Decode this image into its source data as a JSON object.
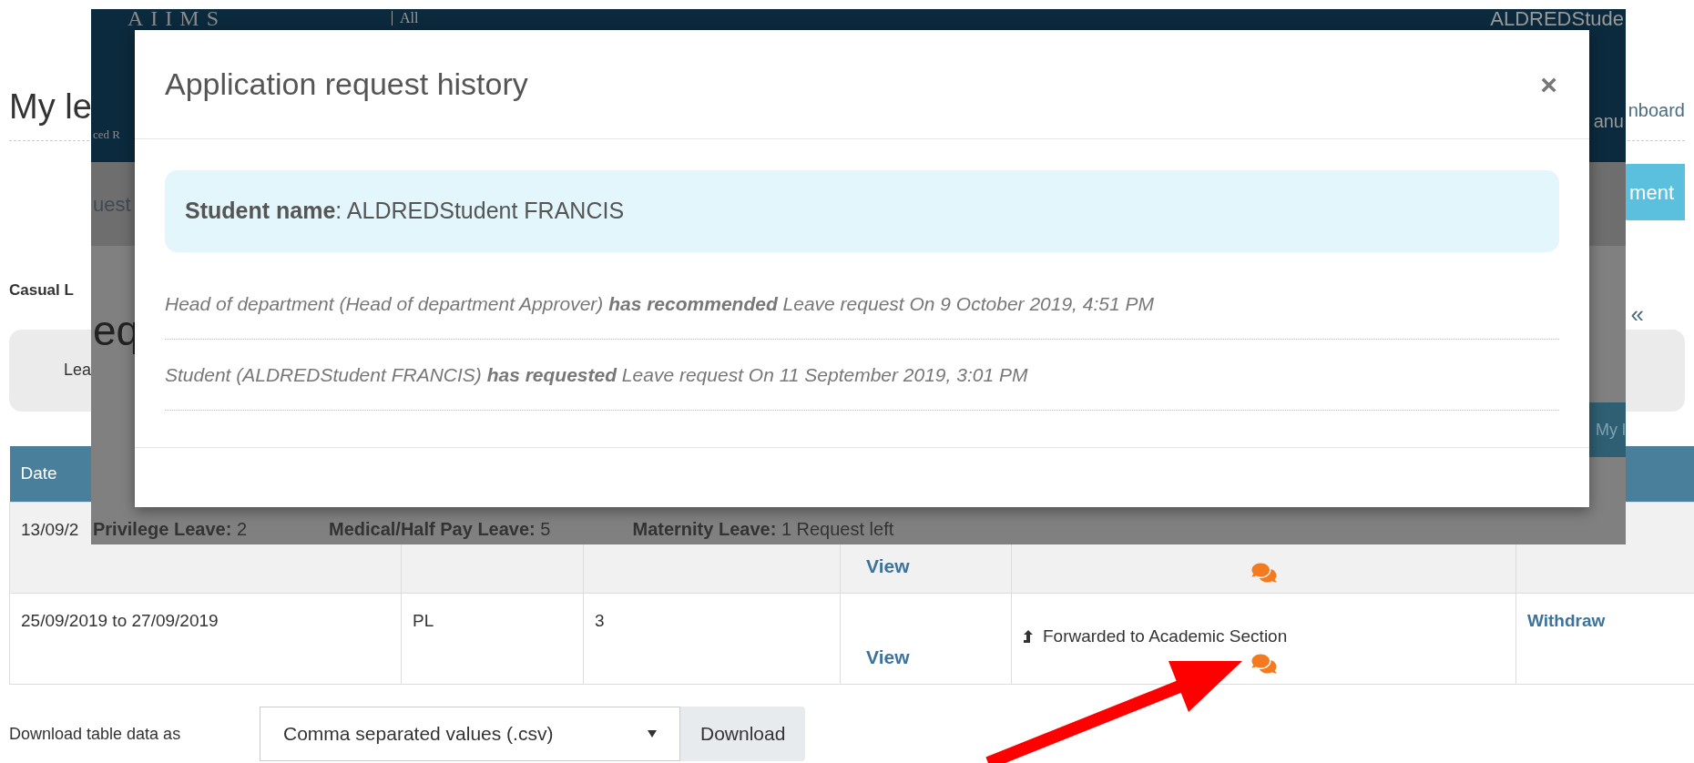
{
  "page": {
    "heading": "My le",
    "top_link": "nboard",
    "action_button": "ment",
    "leave_summary_label": "Casual L",
    "filter_panel_label": "Lea",
    "collapse_toggle": "«"
  },
  "table": {
    "columns": [
      "Date"
    ],
    "rows": [
      {
        "date": "13/09/2",
        "view": "View",
        "has_comments": true
      },
      {
        "date": "25/09/2019 to 27/09/2019",
        "type": "PL",
        "days": "3",
        "view": "View",
        "status": "Forwarded to Academic Section",
        "has_comments": true,
        "action": "Withdraw"
      }
    ]
  },
  "download": {
    "label": "Download table data as",
    "format": "Comma separated values (.csv)",
    "button": "Download"
  },
  "background_screenshot": {
    "logo": "AIIMS",
    "logo_subtitle": "All",
    "logo_tagline": "ced R",
    "user_name": "ALDREDStude",
    "menu_fragment": "anu",
    "tab_fragment": "uest",
    "heading_fragment": "eq",
    "table_header_fragment": "My l",
    "leave_balances": [
      {
        "label": "Privilege Leave:",
        "value": "2"
      },
      {
        "label": "Medical/Half Pay Leave:",
        "value": "5"
      },
      {
        "label": "Maternity Leave:",
        "value": "1 Request left"
      }
    ]
  },
  "modal": {
    "title": "Application request history",
    "close": "×",
    "student": "**Student name**: ALDREDStudent FRANCIS",
    "history": [
      "Head of department (Head of department Approver) **has recommended** Leave request On 9 October 2019, 4:51 PM",
      "Student (ALDREDStudent FRANCIS) **has requested** Leave request On 11 September 2019, 3:01 PM"
    ]
  }
}
